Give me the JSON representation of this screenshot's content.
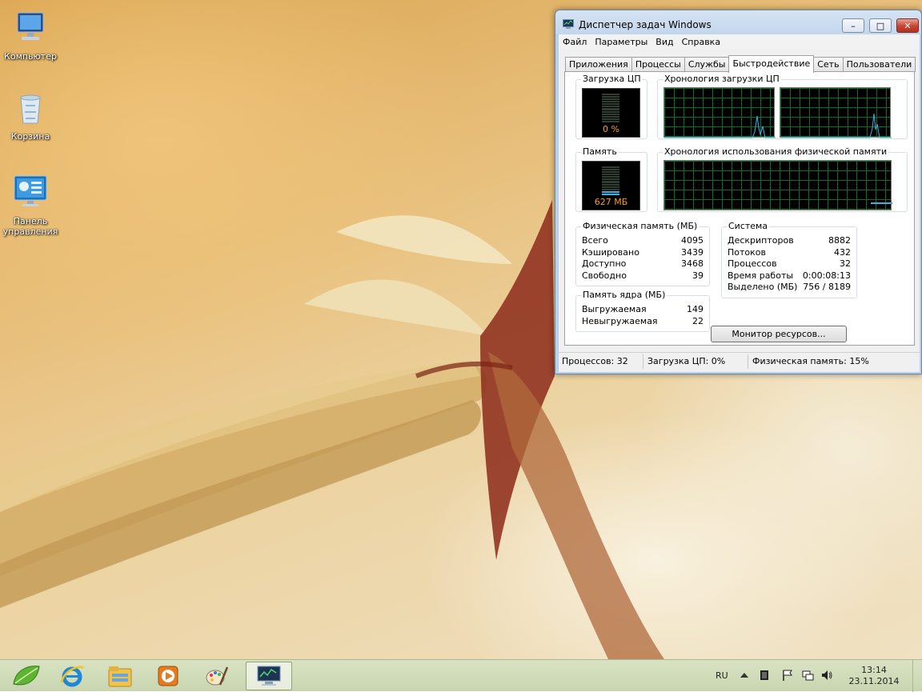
{
  "desktop": {
    "icons": [
      {
        "label": "Компьютер",
        "icon": "computer-icon"
      },
      {
        "label": "Корзина",
        "icon": "recycle-bin-icon"
      },
      {
        "label": "Панель управления",
        "icon": "control-panel-icon"
      }
    ]
  },
  "window": {
    "title": "Диспетчер задач Windows",
    "minimize_glyph": "–",
    "maximize_glyph": "□",
    "close_glyph": "✕",
    "menu": [
      "Файл",
      "Параметры",
      "Вид",
      "Справка"
    ],
    "tabs": [
      "Приложения",
      "Процессы",
      "Службы",
      "Быстродействие",
      "Сеть",
      "Пользователи"
    ],
    "active_tab": "Быстродействие"
  },
  "performance": {
    "cpu_usage": {
      "title": "Загрузка ЦП",
      "value_text": "0 %",
      "level": 0.0
    },
    "cpu_history": {
      "title": "Хронология загрузки ЦП"
    },
    "memory": {
      "title": "Память",
      "value_text": "627 МБ",
      "level": 0.15
    },
    "memory_history": {
      "title": "Хронология использования физической памяти"
    },
    "physical_memory": {
      "title": "Физическая память (МБ)",
      "rows": [
        {
          "label": "Всего",
          "value": "4095"
        },
        {
          "label": "Кэшировано",
          "value": "3439"
        },
        {
          "label": "Доступно",
          "value": "3468"
        },
        {
          "label": "Свободно",
          "value": "39"
        }
      ]
    },
    "kernel_memory": {
      "title": "Память ядра (МБ)",
      "rows": [
        {
          "label": "Выгружаемая",
          "value": "149"
        },
        {
          "label": "Невыгружаемая",
          "value": "22"
        }
      ]
    },
    "system": {
      "title": "Система",
      "rows": [
        {
          "label": "Дескрипторов",
          "value": "8882"
        },
        {
          "label": "Потоков",
          "value": "432"
        },
        {
          "label": "Процессов",
          "value": "32"
        },
        {
          "label": "Время работы",
          "value": "0:00:08:13"
        },
        {
          "label": "Выделено (МБ)",
          "value": "756 / 8189"
        }
      ]
    },
    "resource_monitor_button": "Монитор ресурсов..."
  },
  "statusbar": {
    "processes": "Процессов: 32",
    "cpu": "Загрузка ЦП: 0%",
    "memory": "Физическая память: 15%"
  },
  "taskbar": {
    "buttons": [
      {
        "name": "start",
        "icon": "start-leaf-icon"
      },
      {
        "name": "internet-explorer",
        "icon": "internet-explorer-icon"
      },
      {
        "name": "explorer",
        "icon": "folder-explorer-icon"
      },
      {
        "name": "media-player",
        "icon": "media-player-icon"
      },
      {
        "name": "paint",
        "icon": "paint-palette-icon"
      },
      {
        "name": "task-manager",
        "icon": "task-manager-icon"
      }
    ],
    "tray": {
      "language": "RU",
      "time": "13:14",
      "date": "23.11.2014"
    }
  },
  "colors": {
    "window_frame": "#b9d1ea",
    "graph_grid": "#0d6e2c",
    "graph_line": "#3fb0e6",
    "meter_text": "#f5a023",
    "taskbar": "#d0dbba"
  }
}
